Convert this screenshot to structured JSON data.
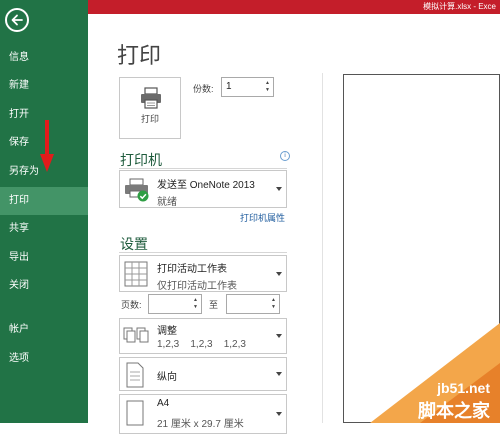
{
  "window": {
    "title": "模拟计算.xlsx - Exce"
  },
  "sidebar": {
    "items": [
      {
        "label": "信息"
      },
      {
        "label": "新建"
      },
      {
        "label": "打开"
      },
      {
        "label": "保存"
      },
      {
        "label": "另存为"
      },
      {
        "label": "打印"
      },
      {
        "label": "共享"
      },
      {
        "label": "导出"
      },
      {
        "label": "关闭"
      },
      {
        "label": "帐户"
      },
      {
        "label": "选项"
      }
    ],
    "active_item": "打印"
  },
  "main": {
    "title": "打印",
    "print_button_label": "打印",
    "copies_label": "份数:",
    "copies_value": "1"
  },
  "printer": {
    "section_title": "打印机",
    "name": "发送至 OneNote 2013",
    "status": "就绪",
    "properties_link": "打印机属性"
  },
  "settings": {
    "section_title": "设置",
    "scope": {
      "primary": "打印活动工作表",
      "secondary": "仅打印活动工作表"
    },
    "pages_label": "页数:",
    "to_label": "至",
    "collate": {
      "primary": "调整",
      "secondary": "1,2,3    1,2,3    1,2,3"
    },
    "orientation": {
      "primary": "纵向"
    },
    "paper": {
      "primary": "A4",
      "secondary": "21 厘米 x 29.7 厘米"
    }
  },
  "watermark": {
    "line1": "jb51.net",
    "line2": "脚本之家"
  },
  "colors": {
    "sidebar": "#217346",
    "active": "#439467",
    "titlebar": "#c41e2a",
    "arrow": "#e21b1b"
  }
}
